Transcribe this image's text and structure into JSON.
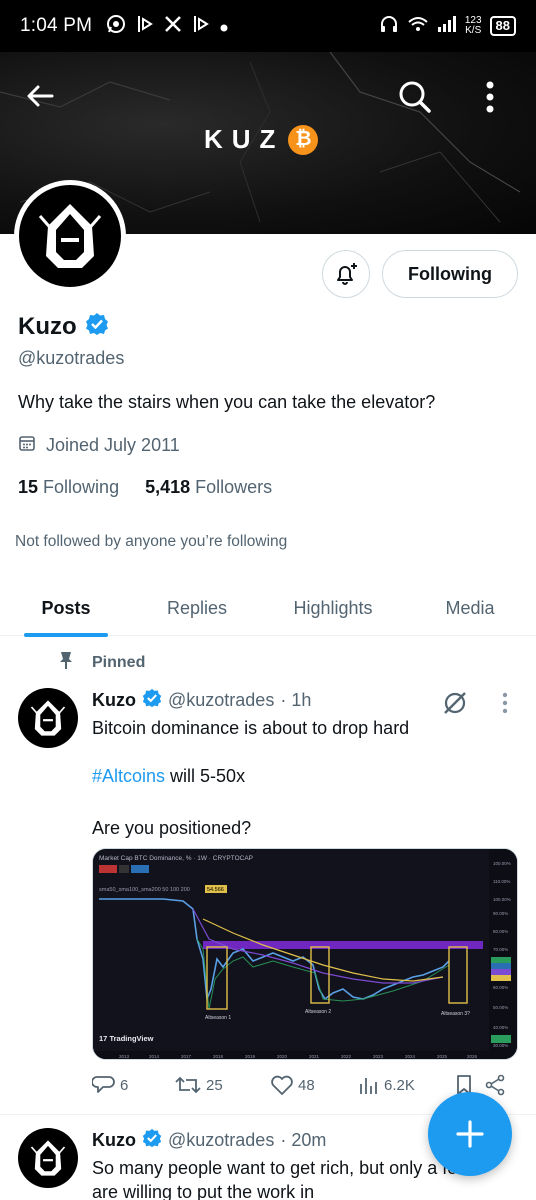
{
  "status_bar": {
    "time": "1:04 PM",
    "net_speed_top": "123",
    "net_speed_unit": "K/S",
    "battery": "88"
  },
  "banner": {
    "brand_text": "KUZ",
    "brand_coin": "₿"
  },
  "profile": {
    "name": "Kuzo",
    "handle": "@kuzotrades",
    "bio": "Why take the stairs when you can take the elevator?",
    "joined": "Joined July 2011",
    "following_count": "15",
    "following_label": "Following",
    "followers_count": "5,418",
    "followers_label": "Followers",
    "not_followed_text": "Not followed by anyone you’re following",
    "follow_button_label": "Following"
  },
  "tabs": [
    {
      "label": "Posts",
      "active": true
    },
    {
      "label": "Replies",
      "active": false
    },
    {
      "label": "Highlights",
      "active": false
    },
    {
      "label": "Media",
      "active": false
    }
  ],
  "pinned_label": "Pinned",
  "tweets": [
    {
      "name": "Kuzo",
      "handle": "@kuzotrades",
      "time": "· 1h",
      "line1": "Bitcoin dominance is about to drop hard",
      "hashtag": "#Altcoins",
      "line2_rest": " will 5-50x",
      "line3": "Are you positioned?",
      "replies": "6",
      "reposts": "25",
      "likes": "48",
      "views": "6.2K"
    },
    {
      "name": "Kuzo",
      "handle": "@kuzotrades",
      "time": "· 20m",
      "line1": "So many people want to get rich, but only a few",
      "line2": "are willing to put the work in"
    }
  ],
  "chart_image": {
    "header": "Market Cap BTC Dominance, % · 1W · CRYPTOCAP",
    "indicator": "sma50_sma100_sma200 50 100 200",
    "indicator_value": "54.566",
    "watermark": "TradingView",
    "labels": [
      "Altseason 1",
      "Altseason 2",
      "Altseason 3?"
    ],
    "x_ticks": [
      "2013",
      "2014",
      "2017",
      "2018",
      "2019",
      "2020",
      "2021",
      "2022",
      "2023",
      "2024",
      "2025",
      "2026"
    ],
    "y_ticks": [
      "100.00%",
      "110.00%",
      "100.00%",
      "90.00%",
      "80.00%",
      "70.00%",
      "60.00%",
      "50.00%",
      "40.00%",
      "30.00%"
    ]
  },
  "colors": {
    "accent": "#1d9bf0",
    "text": "#0f1419",
    "muted": "#536471",
    "bitcoin": "#f7931a"
  }
}
